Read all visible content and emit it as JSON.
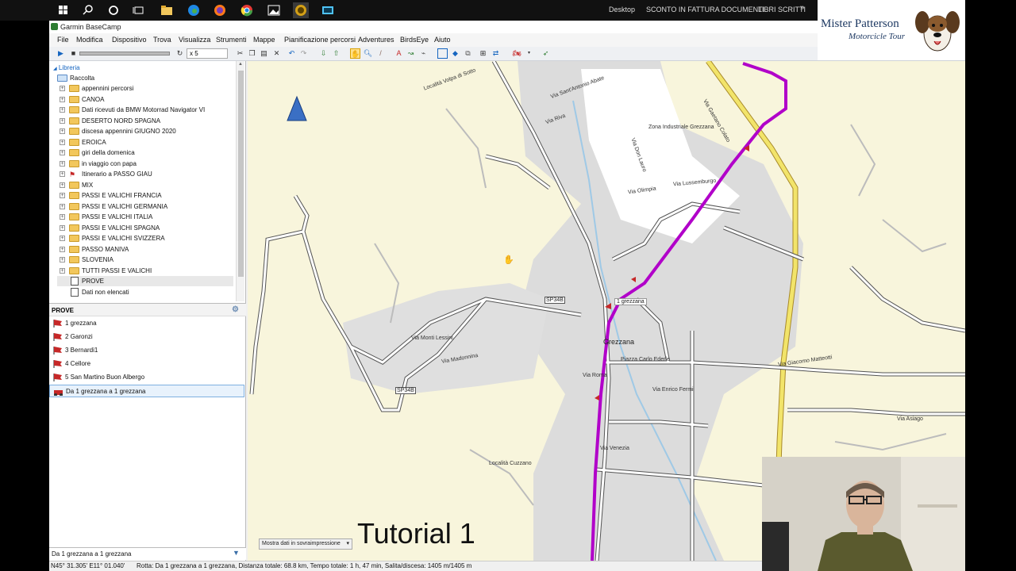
{
  "taskbar": {
    "desktop_label": "Desktop",
    "item1": "SCONTO IN FATTURA DOCUMENTI",
    "item2": "LIBRI SCRITTI"
  },
  "window": {
    "title": "Garmin BaseCamp"
  },
  "menu": [
    "File",
    "Modifica",
    "Dispositivo",
    "Trova",
    "Visualizza",
    "Strumenti",
    "Mappe",
    "Pianificazione percorsi",
    "Adventures",
    "BirdsEye",
    "Aiuto"
  ],
  "toolbar": {
    "speed_value": "x 5"
  },
  "library": {
    "title": "Libreria",
    "root": "Raccolta",
    "items": [
      "appennini percorsi",
      "CANOA",
      "Dati ricevuti da BMW Motorrad Navigator VI",
      "DESERTO NORD SPAGNA",
      "discesa appennini GIUGNO 2020",
      "EROICA",
      "giri della domenica",
      "in viaggio con papa",
      "Itinerario a PASSO GIAU",
      "MIX",
      "PASSI E VALICHI FRANCIA",
      "PASSI E VALICHI GERMANIA",
      "PASSI E VALICHI ITALIA",
      "PASSI E VALICHI SPAGNA",
      "PASSI E VALICHI SVIZZERA",
      "PASSO MANIVA",
      "SLOVENIA",
      "TUTTI PASSI E VALICHI",
      "PROVE",
      "Dati non elencati"
    ]
  },
  "list_panel": {
    "title": "PROVE",
    "items": [
      "1 grezzana",
      "2 Garonzi",
      "3 Bernardi1",
      "4 Cellore",
      "5 San Martino Buon Albergo",
      "Da 1 grezzana a 1 grezzana"
    ],
    "filter_value": "Da 1 grezzana a 1 grezzana"
  },
  "map": {
    "labels": {
      "l1": "Località Volpa di Sotto",
      "l2": "Zona Industriale Grezzana",
      "l3": "Via Lussemburgo",
      "l4": "Via Olimpia",
      "l5": "Grezzana",
      "l6": "1 grezzana",
      "l7": "Piazza Carlo Ederle",
      "l8": "Via Enrico Fermi",
      "l9": "Via Monti Lessini",
      "l10": "Via Madonnina",
      "l11": "SP34B",
      "l12": "SP34B",
      "l13": "Località Cuzzano",
      "l14": "Via Venezia",
      "l15": "Via Roma",
      "l16": "Via Asiago",
      "l17": "Via Giacomo Matteotti",
      "l18": "Via Gaetano Colato",
      "l19": "Via Riva",
      "l20": "Via Sant'Antonio Abate",
      "l21": "Via Don Lauro"
    },
    "overlay_dropdown": "Mostra dati in sovraimpressione",
    "caption": "Tutorial 1",
    "colors": {
      "route": "#b100c9",
      "highway": "#f2e46a",
      "urban": "#dcdcdc",
      "water": "#9fc9e6",
      "background": "#f8f5dc"
    }
  },
  "status": {
    "coords": "N45° 31.305' E11° 01.040'",
    "route_info": "Rotta: Da 1 grezzana a 1 grezzana, Distanza totale: 68.8 km, Tempo totale: 1 h, 47 min, Salita/discesa: 1405 m/1405 m"
  },
  "logo": {
    "line1": "Mister Patterson",
    "line2": "Motorcicle Tour"
  }
}
